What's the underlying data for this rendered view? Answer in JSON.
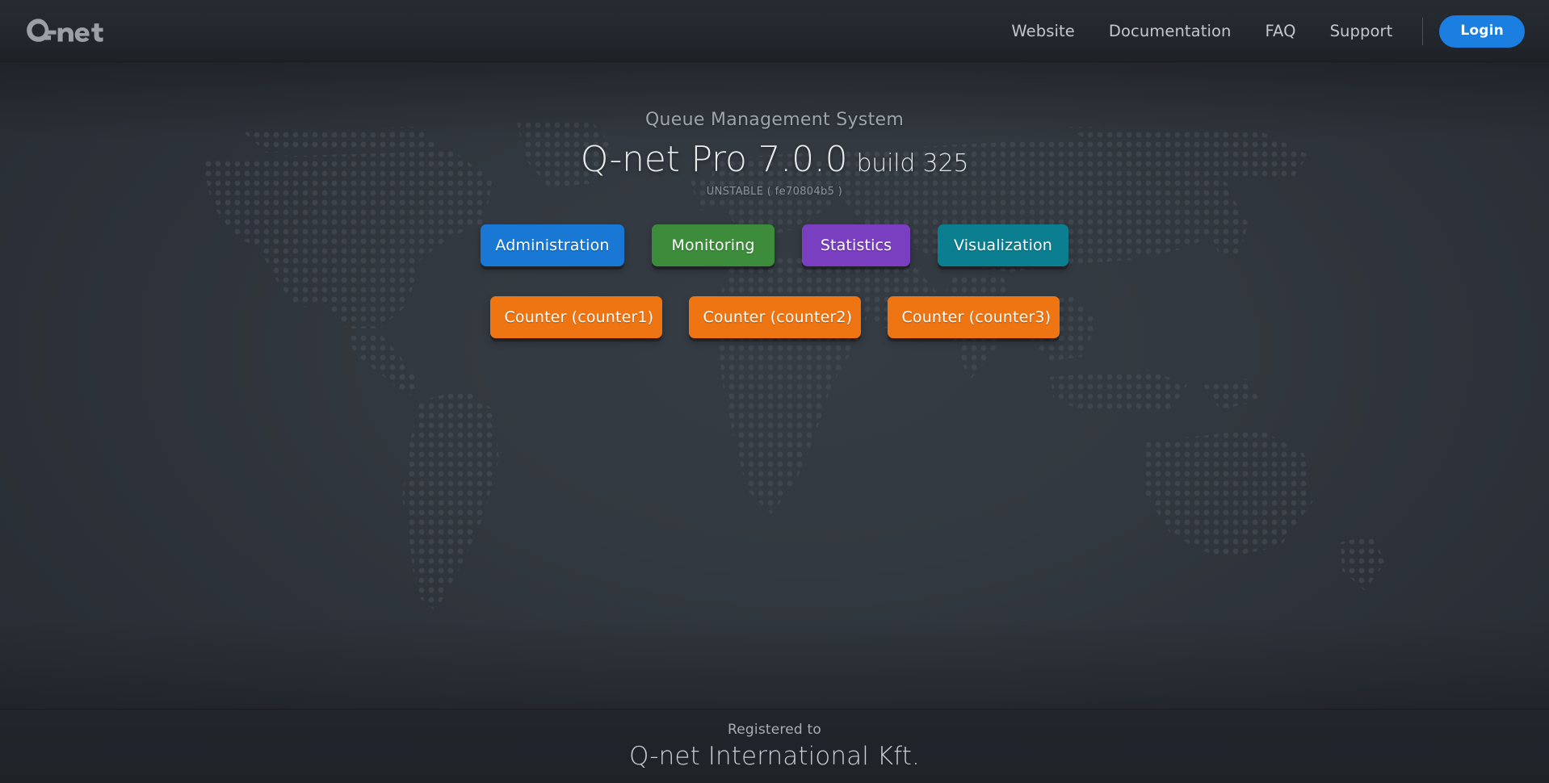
{
  "header": {
    "logo_text": "Q-net",
    "logo_icon": "qnet-logo",
    "nav": [
      {
        "label": "Website",
        "name": "nav-link-website"
      },
      {
        "label": "Documentation",
        "name": "nav-link-documentation"
      },
      {
        "label": "FAQ",
        "name": "nav-link-faq"
      },
      {
        "label": "Support",
        "name": "nav-link-support"
      }
    ],
    "login_label": "Login",
    "login_color": "#1a7fe0"
  },
  "hero": {
    "subtitle": "Queue Management System",
    "product": "Q-net Pro 7.0.0",
    "build": "build 325",
    "build_hash": "UNSTABLE ( fe70804b5 )"
  },
  "modules": [
    {
      "label": "Administration",
      "color": "#1878d4",
      "name": "module-button-administration"
    },
    {
      "label": "Monitoring",
      "color": "#3c8c3c",
      "name": "module-button-monitoring"
    },
    {
      "label": "Statistics",
      "color": "#7a3fc0",
      "name": "module-button-statistics"
    },
    {
      "label": "Visualization",
      "color": "#0b7f8f",
      "name": "module-button-visualization"
    }
  ],
  "counters": [
    {
      "label": "Counter (counter1)",
      "color": "#ef7412",
      "name": "counter-button-counter1"
    },
    {
      "label": "Counter (counter2)",
      "color": "#ef7412",
      "name": "counter-button-counter2"
    },
    {
      "label": "Counter (counter3)",
      "color": "#ef7412",
      "name": "counter-button-counter3"
    }
  ],
  "footer": {
    "label": "Registered to",
    "company": "Q-net International Kft."
  }
}
